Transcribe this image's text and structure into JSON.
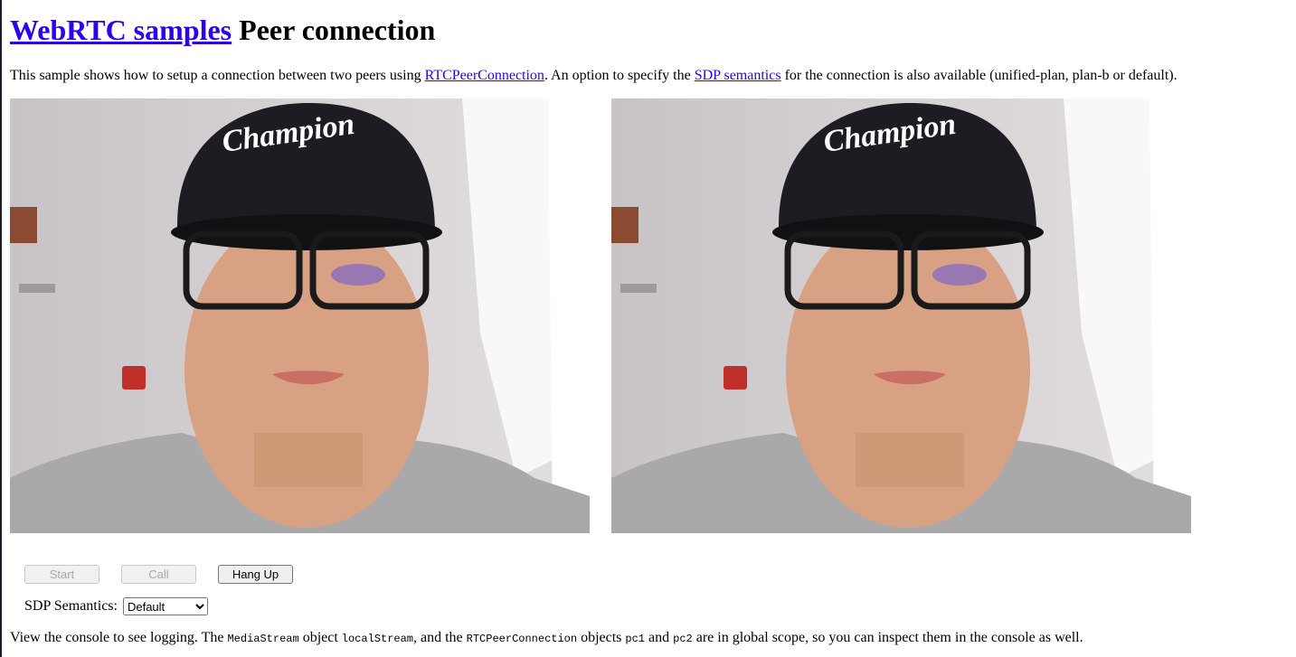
{
  "header": {
    "link_text": "WebRTC samples",
    "title": "Peer connection"
  },
  "intro": {
    "before_link1": "This sample shows how to setup a connection between two peers using ",
    "link1": "RTCPeerConnection",
    "between_links": ". An option to specify the ",
    "link2": "SDP semantics",
    "after_link2": " for the connection is also available (unified-plan, plan-b or default)."
  },
  "videos": {
    "local": "webcam-feed-person-wearing-cap-and-glasses",
    "remote": "webcam-feed-person-wearing-cap-and-glasses"
  },
  "controls": {
    "start_label": "Start",
    "call_label": "Call",
    "hangup_label": "Hang Up",
    "start_disabled": true,
    "call_disabled": true
  },
  "sdp": {
    "label": "SDP Semantics:",
    "selected": "Default"
  },
  "footer": {
    "text1": "View the console to see logging. The ",
    "code1": "MediaStream",
    "text2": " object ",
    "code2": "localStream",
    "text3": ", and the ",
    "code3": "RTCPeerConnection",
    "text4": " objects ",
    "code4": "pc1",
    "text5": " and ",
    "code5": "pc2",
    "text6": " are in global scope, so you can inspect them in the console as well."
  },
  "colors": {
    "link": "#2d00ee",
    "button_bg": "#efefef",
    "button_disabled_text": "#a8a8a8"
  }
}
